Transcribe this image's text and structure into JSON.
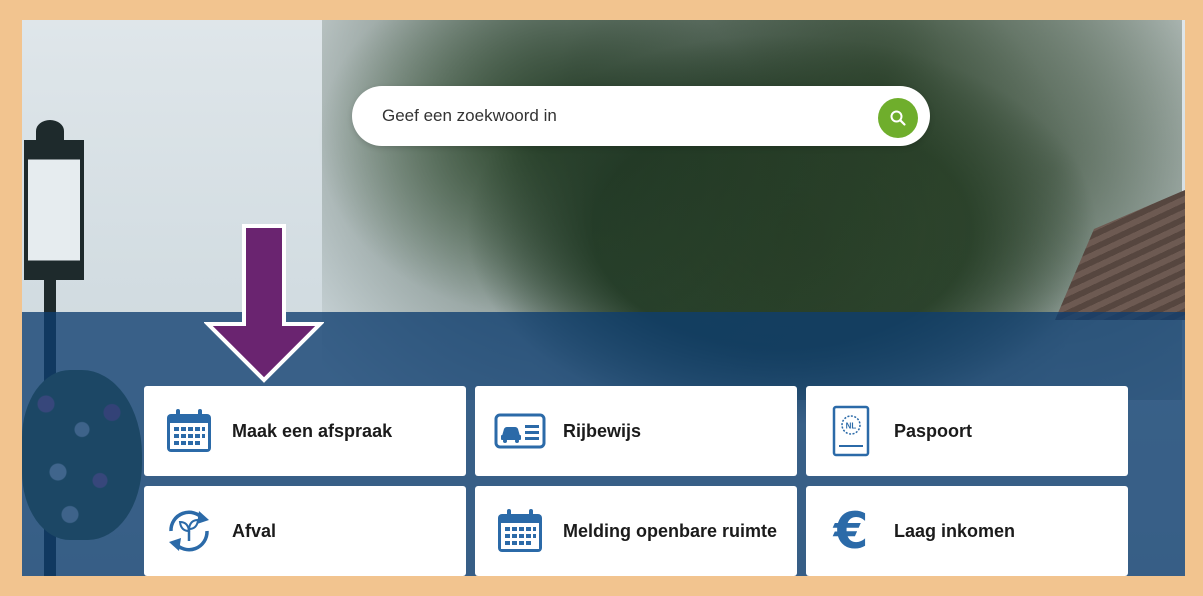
{
  "search": {
    "placeholder": "Geef een zoekwoord in",
    "button_icon": "search-icon"
  },
  "colors": {
    "frame": "#f2c48f",
    "band": "#0e3e70",
    "accent_green": "#6fae2c",
    "icon_blue": "#2b6aa8",
    "arrow": "#6a2470"
  },
  "tiles": [
    {
      "label": "Maak een afspraak",
      "icon": "calendar-icon"
    },
    {
      "label": "Rijbewijs",
      "icon": "driving-license-icon"
    },
    {
      "label": "Paspoort",
      "icon": "passport-icon"
    },
    {
      "label": "Afval",
      "icon": "recycle-icon"
    },
    {
      "label": "Melding openbare ruimte",
      "icon": "calendar-icon"
    },
    {
      "label": "Laag inkomen",
      "icon": "euro-icon"
    }
  ],
  "passport_badge": "NL",
  "euro_symbol": "€"
}
